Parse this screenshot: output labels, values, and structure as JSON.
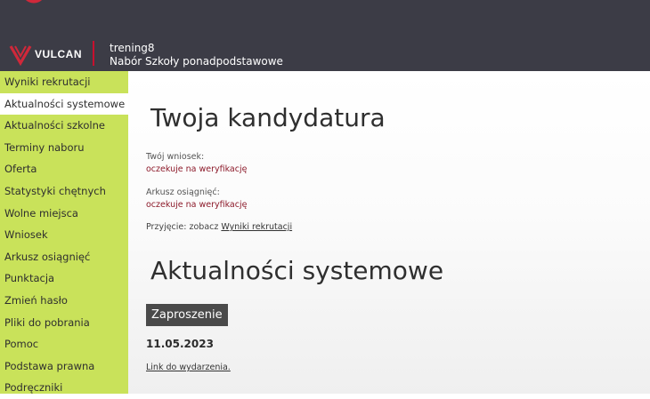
{
  "header": {
    "brand": "VULCAN",
    "school_name": "trening8",
    "system_name": "Nabór Szkoły ponadpodstawowe"
  },
  "sidebar": {
    "items": [
      {
        "label": "Wyniki rekrutacji"
      },
      {
        "label": "Aktualności systemowe"
      },
      {
        "label": "Aktualności szkolne"
      },
      {
        "label": "Terminy naboru"
      },
      {
        "label": "Oferta"
      },
      {
        "label": "Statystyki chętnych"
      },
      {
        "label": "Wolne miejsca"
      },
      {
        "label": "Wniosek"
      },
      {
        "label": "Arkusz osiągnięć"
      },
      {
        "label": "Punktacja"
      },
      {
        "label": "Zmień hasło"
      },
      {
        "label": "Pliki do pobrania"
      },
      {
        "label": "Pomoc"
      },
      {
        "label": "Podstawa prawna"
      },
      {
        "label": "Podręczniki"
      }
    ]
  },
  "candidacy": {
    "title": "Twoja kandydatura",
    "application_label": "Twój wniosek:",
    "application_status": "oczekuje na weryfikację",
    "achievements_label": "Arkusz osiągnięć:",
    "achievements_status": "oczekuje na weryfikację",
    "admission_prefix": "Przyjęcie: zobacz",
    "admission_link": "Wyniki rekrutacji"
  },
  "news": {
    "title": "Aktualności systemowe",
    "item": {
      "badge": "Zaproszenie",
      "date": "11.05.2023",
      "link": "Link do wydarzenia."
    }
  },
  "colors": {
    "topbar": "#3c3c46",
    "sidebar": "#c9e25a",
    "brand_red": "#c8102e",
    "status_red": "#8c1a2a"
  }
}
